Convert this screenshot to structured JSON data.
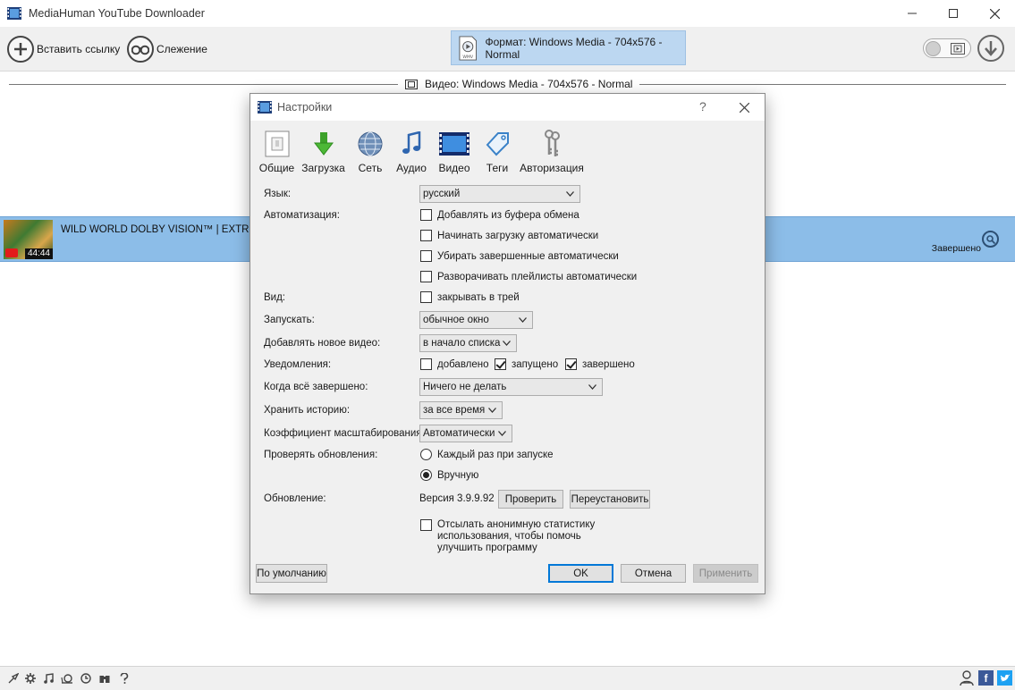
{
  "window": {
    "title": "MediaHuman YouTube Downloader"
  },
  "toolbar": {
    "paste_link": "Вставить ссылку",
    "tracking": "Слежение",
    "format": "Формат: Windows Media - 704x576 - Normal",
    "format_doc_caption": "WMV"
  },
  "format_header": "Видео: Windows Media - 704x576 - Normal",
  "item": {
    "title": "WILD WORLD DOLBY VISION™ | EXTREME C",
    "duration": "44:44",
    "status": "Завершено"
  },
  "dialog": {
    "title": "Настройки",
    "help": "?",
    "tabs": [
      {
        "label": "Общие",
        "icon": "general-icon"
      },
      {
        "label": "Загрузка",
        "icon": "download-arrow-icon"
      },
      {
        "label": "Сеть",
        "icon": "globe-icon"
      },
      {
        "label": "Аудио",
        "icon": "music-note-icon"
      },
      {
        "label": "Видео",
        "icon": "film-icon"
      },
      {
        "label": "Теги",
        "icon": "tag-icon"
      },
      {
        "label": "Авторизация",
        "icon": "keys-icon"
      }
    ],
    "labels": {
      "language": "Язык:",
      "automation": "Автоматизация:",
      "view": "Вид:",
      "launch": "Запускать:",
      "add_new": "Добавлять новое видео:",
      "notifications": "Уведомления:",
      "when_done": "Когда всё завершено:",
      "history": "Хранить историю:",
      "scale": "Коэффициент масштабирования:",
      "check_updates": "Проверять обновления:",
      "update": "Обновление:"
    },
    "language": "русский",
    "automation": [
      {
        "label": "Добавлять из буфера обмена",
        "checked": false
      },
      {
        "label": "Начинать загрузку автоматически",
        "checked": false
      },
      {
        "label": "Убирать завершенные автоматически",
        "checked": false
      },
      {
        "label": "Разворачивать плейлисты автоматически",
        "checked": false
      }
    ],
    "tray": {
      "label": "закрывать в трей",
      "checked": false
    },
    "launch": "обычное окно",
    "add_new": "в начало списка",
    "notifications": [
      {
        "label": "добавлено",
        "checked": false
      },
      {
        "label": "запущено",
        "checked": true
      },
      {
        "label": "завершено",
        "checked": true
      }
    ],
    "when_done": "Ничего не делать",
    "history": "за все время",
    "scale": "Автоматически",
    "update_check": [
      {
        "label": "Каждый раз при запуске",
        "selected": false
      },
      {
        "label": "Вручную",
        "selected": true
      }
    ],
    "version": "Версия 3.9.9.92",
    "check_button": "Проверить",
    "reinstall_button": "Переустановить",
    "stats": {
      "line1": "Отсылать анонимную статистику",
      "line2": "использования, чтобы помочь",
      "line3": "улучшить программу",
      "checked": false
    },
    "defaults_button": "По умолчанию",
    "ok_button": "OK",
    "cancel_button": "Отмена",
    "apply_button": "Применить"
  },
  "colors": {
    "selected_row": "#8cbde8",
    "format_button": "#bcd7f1",
    "facebook": "#3b5998",
    "twitter": "#1da1f2"
  }
}
